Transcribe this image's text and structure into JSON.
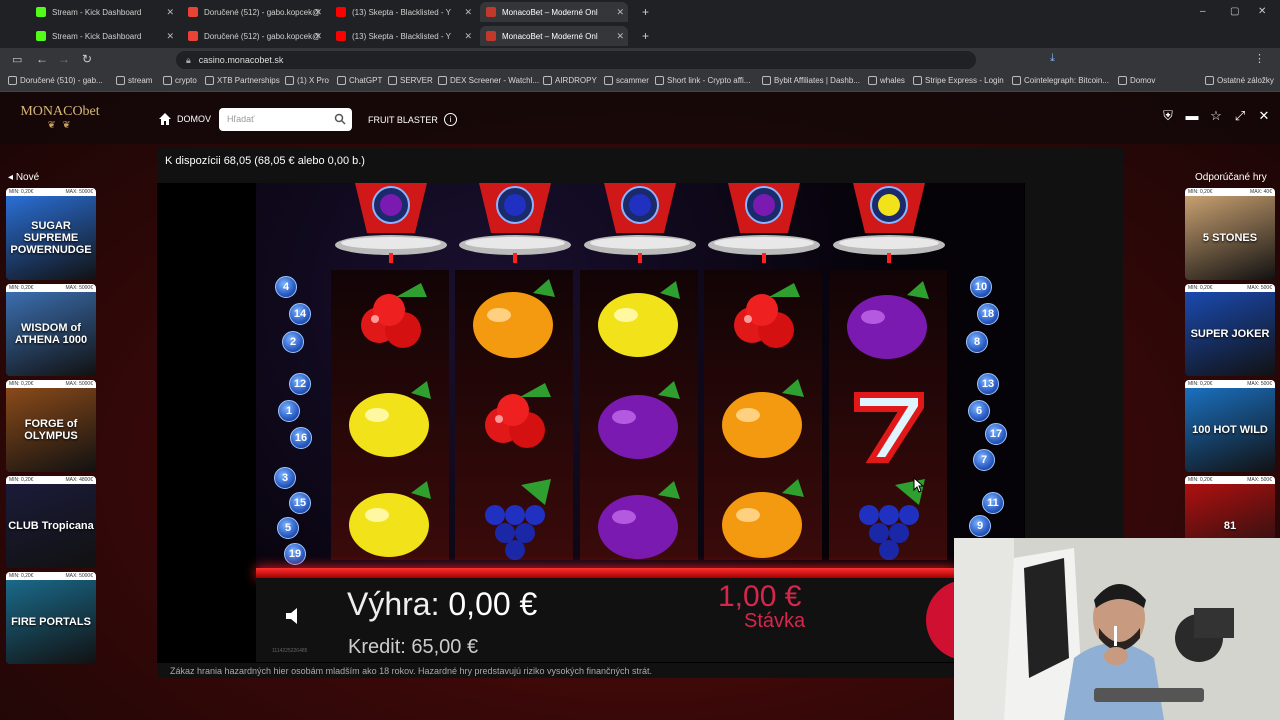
{
  "browser": {
    "tabs_row1": [
      {
        "label": "Stream - Kick Dashboard",
        "color": "#53fc18"
      },
      {
        "label": "Doručené (512) - gabo.kopcek@",
        "color": "#ea4335"
      },
      {
        "label": "(13) Skepta - Blacklisted - Y",
        "color": "#ff0000"
      },
      {
        "label": "MonacoBet – Moderné Onl",
        "color": "#c0392b"
      }
    ],
    "tabs_row2": [
      {
        "label": "Stream - Kick Dashboard",
        "color": "#53fc18"
      },
      {
        "label": "Doručené (512) - gabo.kopcek@",
        "color": "#ea4335"
      },
      {
        "label": "(13) Skepta - Blacklisted - Y",
        "color": "#ff0000"
      },
      {
        "label": "MonacoBet – Moderné Onl",
        "color": "#c0392b"
      }
    ],
    "url": "casino.monacobet.sk",
    "bookmarks": [
      "Doručené (510) - gab...",
      "stream",
      "crypto",
      "XTB Partnerships",
      "(1) X Pro",
      "ChatGPT",
      "SERVER",
      "DEX Screener - Watchl...",
      "AIRDROPY",
      "scammer",
      "Short link - Crypto affi...",
      "Bybit Affiliates | Dashb...",
      "whales",
      "Stripe Express - Login",
      "Cointelegraph: Bitcoin...",
      "Domov"
    ],
    "other_bookmarks": "Ostatné záložky"
  },
  "site": {
    "logo": "MONACObet",
    "home": "DOMOV",
    "search_placeholder": "Hľadať",
    "game_title": "FRUIT BLASTER",
    "available": "K dispozícii 68,05 (68,05 € alebo 0,00 b.)",
    "left_label": "Nové",
    "right_label": "Odporúčané hry",
    "left_games": [
      {
        "name": "SUGAR SUPREME POWERNUDGE",
        "min": "MIN: 0,20€",
        "max": "MAX: 5000€",
        "color": "#2a6fd6"
      },
      {
        "name": "WISDOM of ATHENA 1000",
        "min": "MIN: 0,20€",
        "max": "MAX: 5000€",
        "color": "#3b6fb0"
      },
      {
        "name": "FORGE of OLYMPUS",
        "min": "MIN: 0,20€",
        "max": "MAX: 5000€",
        "color": "#8a4a1a"
      },
      {
        "name": "CLUB Tropicana",
        "min": "MIN: 0,20€",
        "max": "MAX: 4800€",
        "color": "#1b1b3a"
      },
      {
        "name": "FIRE PORTALS",
        "min": "MIN: 0,20€",
        "max": "MAX: 5000€",
        "color": "#1a6a8a"
      }
    ],
    "right_games": [
      {
        "name": "5 STONES",
        "min": "MIN: 0,20€",
        "max": "MAX: 40€",
        "color": "#c8a070"
      },
      {
        "name": "SUPER JOKER",
        "min": "MIN: 0,20€",
        "max": "MAX: 500€",
        "color": "#1a4ab0"
      },
      {
        "name": "100 HOT WILD",
        "min": "MIN: 0,20€",
        "max": "MAX: 500€",
        "color": "#1a70c0"
      },
      {
        "name": "81",
        "min": "MIN: 0,20€",
        "max": "MAX: 500€",
        "color": "#b01010"
      }
    ]
  },
  "game": {
    "win_label": "Výhra:",
    "win_value": "0,00 €",
    "credit_label": "Kredit:",
    "credit_value": "65,00 €",
    "bet_value": "1,00 €",
    "bet_label": "Stávka",
    "disclaimer": "Zákaz hrania hazardných hier osobám mladším ako 18 rokov. Hazardné hry predstavujú riziko vysokých finančných strát.",
    "ufo_balls": [
      "plum",
      "grapes",
      "grapes",
      "plum",
      "lemon"
    ],
    "reels": [
      [
        "cherry",
        "lemon",
        "lemon"
      ],
      [
        "orange",
        "cherry",
        "grapes"
      ],
      [
        "lemon",
        "plum",
        "plum"
      ],
      [
        "cherry",
        "orange",
        "orange"
      ],
      [
        "plum",
        "seven",
        "grapes"
      ]
    ],
    "left_lines": [
      "4",
      "14",
      "2",
      "12",
      "1",
      "16",
      "3",
      "15",
      "5",
      "19"
    ],
    "right_lines": [
      "10",
      "18",
      "8",
      "13",
      "6",
      "17",
      "7",
      "11",
      "9"
    ],
    "tiny_id": "1114225226485"
  }
}
